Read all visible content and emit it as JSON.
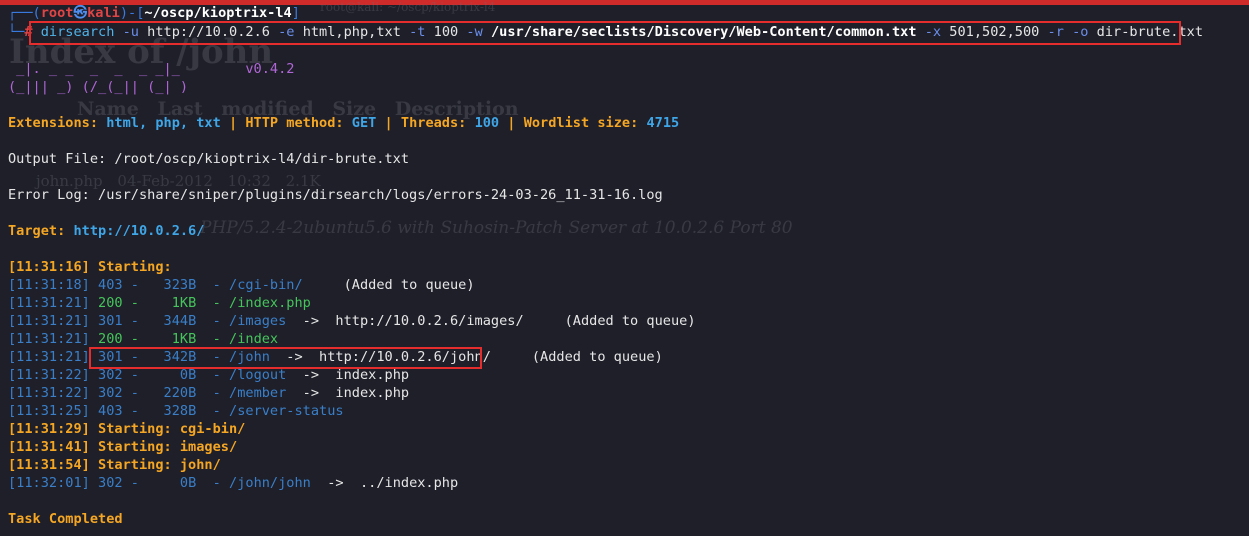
{
  "window": {
    "title_ghost": "root@kali: ~/oscp/kioptrix-l4"
  },
  "background_page": {
    "title": "Index of /john",
    "header": "Name      Last modified     Size Description",
    "row": "john.php        04-Feb-2012 10:32  2.1K",
    "footer": "PHP/5.2.4-2ubuntu5.6 with Suhosin-Patch Server at 10.0.2.6 Port 80"
  },
  "prompt": {
    "open": "┌──(",
    "user": "root",
    "at": "㉿",
    "host": "kali",
    "mid": ")-[",
    "path": "~/oscp/kioptrix-l4",
    "close": "]",
    "second": "└─",
    "hash": "#"
  },
  "command": {
    "program": "dirsearch",
    "u_flag": "-u",
    "url": "http://10.0.2.6",
    "e_flag": "-e",
    "ext": "html,php,txt",
    "t_flag": "-t",
    "threads": "100",
    "w_flag": "-w",
    "wordlist": "/usr/share/seclists/Discovery/Web-Content/common.txt",
    "x_flag": "-x",
    "exclude": "501,502,500",
    "r_flag": "-r",
    "o_flag": "-o",
    "outfile": "dir-brute.txt"
  },
  "banner": {
    "line1": " _|. _ _  _  _  _ _|_",
    "line2": "(_||| _) (/_(_|| (_| )",
    "version": "v0.4.2"
  },
  "info": {
    "ext_label": "Extensions: ",
    "ext_value": "html, php, txt",
    "sep": " | ",
    "method_label": "HTTP method: ",
    "method_value": "GET",
    "threads_label": "Threads: ",
    "threads_value": "100",
    "wordlist_label": "Wordlist size: ",
    "wordlist_value": "4715",
    "output": "Output File: /root/oscp/kioptrix-l4/dir-brute.txt",
    "errorlog": "Error Log: /usr/share/sniper/plugins/dirsearch/logs/errors-24-03-26_11-31-16.log",
    "target_label": "Target: ",
    "target_value": "http://10.0.2.6/"
  },
  "results": [
    {
      "time": "[11:31:16]",
      "text": " Starting: ",
      "type": "start"
    },
    {
      "time": "[11:31:18]",
      "status": "403",
      "size": "  323B",
      "path": "/cgi-bin/",
      "redirect": "",
      "note": "     (Added to queue)"
    },
    {
      "time": "[11:31:21]",
      "status": "200",
      "size": "   1KB",
      "path": "/index.php",
      "redirect": "",
      "note": ""
    },
    {
      "time": "[11:31:21]",
      "status": "301",
      "size": "  344B",
      "path": "/images",
      "redirect": "  ->  http://10.0.2.6/images/",
      "note": "     (Added to queue)"
    },
    {
      "time": "[11:31:21]",
      "status": "200",
      "size": "   1KB",
      "path": "/index",
      "redirect": "",
      "note": ""
    },
    {
      "time": "[11:31:21]",
      "status": "301",
      "size": "  342B",
      "path": "/john",
      "redirect": "  ->  http://10.0.2.6/john/",
      "note": "     (Added to queue)"
    },
    {
      "time": "[11:31:22]",
      "status": "302",
      "size": "    0B",
      "path": "/logout",
      "redirect": "  ->  index.php",
      "note": ""
    },
    {
      "time": "[11:31:22]",
      "status": "302",
      "size": "  220B",
      "path": "/member",
      "redirect": "  ->  index.php",
      "note": ""
    },
    {
      "time": "[11:31:25]",
      "status": "403",
      "size": "  328B",
      "path": "/server-status",
      "redirect": "",
      "note": ""
    },
    {
      "time": "[11:31:29]",
      "text": " Starting: cgi-bin/",
      "type": "start"
    },
    {
      "time": "[11:31:41]",
      "text": " Starting: images/",
      "type": "start"
    },
    {
      "time": "[11:31:54]",
      "text": " Starting: john/",
      "type": "start"
    },
    {
      "time": "[11:32:01]",
      "status": "302",
      "size": "    0B",
      "path": "/john/john",
      "redirect": "  ->  ../index.php",
      "note": ""
    }
  ],
  "footer": {
    "done": "Task Completed"
  },
  "colors": {
    "background": "#1e1f29",
    "highlight": "#e52d2d",
    "yellow": "#f5a623",
    "blue": "#3fa6e8",
    "purple": "#b066d6"
  }
}
